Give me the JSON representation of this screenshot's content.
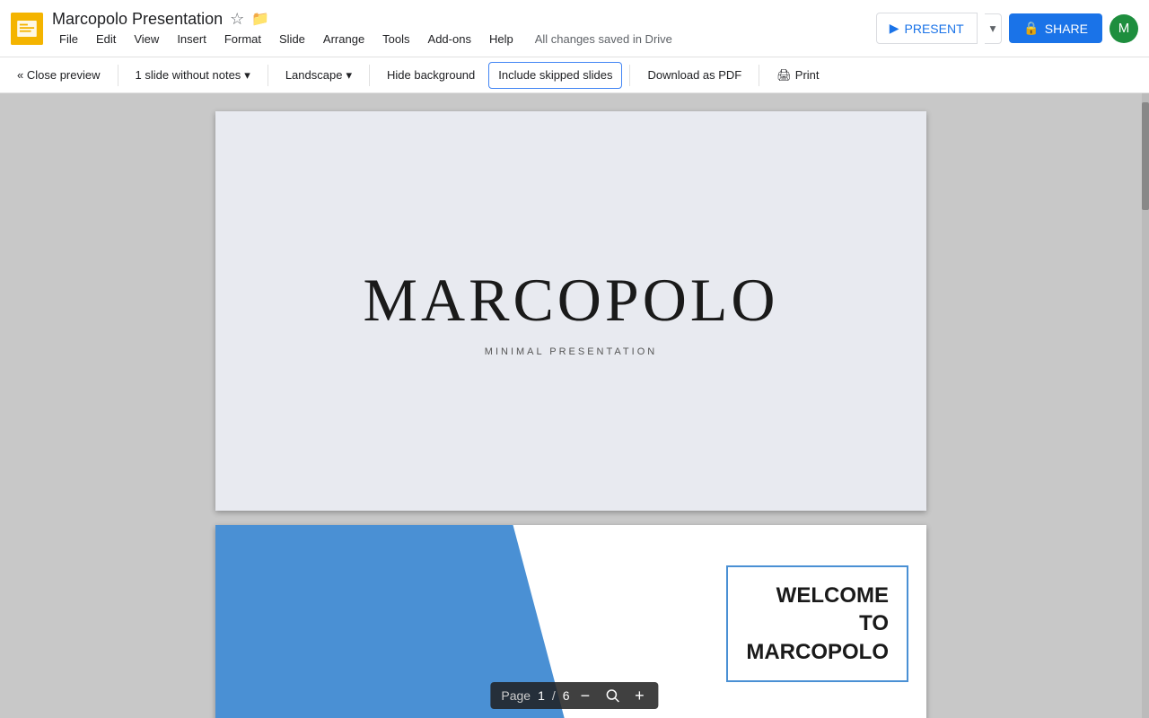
{
  "app": {
    "icon_color": "#F4B400",
    "title": "Marcopolo Presentation",
    "save_status": "All changes saved in Drive"
  },
  "menu": {
    "items": [
      "File",
      "Edit",
      "View",
      "Insert",
      "Format",
      "Slide",
      "Arrange",
      "Tools",
      "Add-ons",
      "Help"
    ]
  },
  "toolbar": {
    "close_preview": "« Close preview",
    "slides_dropdown": "1 slide without notes",
    "orientation": "Landscape",
    "hide_background": "Hide background",
    "include_skipped": "Include skipped slides",
    "download_pdf": "Download as PDF",
    "print": "Print"
  },
  "present_btn": "PRESENT",
  "share_btn": "SHARE",
  "avatar_initial": "M",
  "slide1": {
    "title": "MARCOPOLO",
    "subtitle": "MINIMAL PRESENTATION"
  },
  "slide2": {
    "title": "WELCOME\nTO\nMARCOPOLO"
  },
  "page_controls": {
    "page_label": "Page",
    "current": "1",
    "separator": "/",
    "total": "6"
  }
}
